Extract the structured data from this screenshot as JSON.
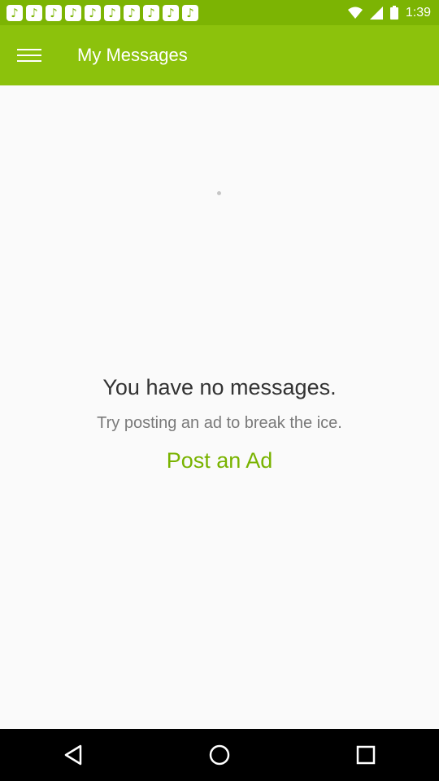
{
  "status_bar": {
    "time": "1:39",
    "notification_count": 10,
    "bg_color": "#7cb403"
  },
  "app_bar": {
    "title": "My Messages",
    "menu_icon": "hamburger-menu-icon",
    "bg_color": "#8cc20c"
  },
  "empty_state": {
    "title": "You have no messages.",
    "subtitle": "Try posting an ad to break the ice.",
    "action_label": "Post an Ad",
    "action_color": "#79b300"
  },
  "nav_bar": {
    "buttons": [
      "back-icon",
      "home-icon",
      "recents-icon"
    ]
  }
}
